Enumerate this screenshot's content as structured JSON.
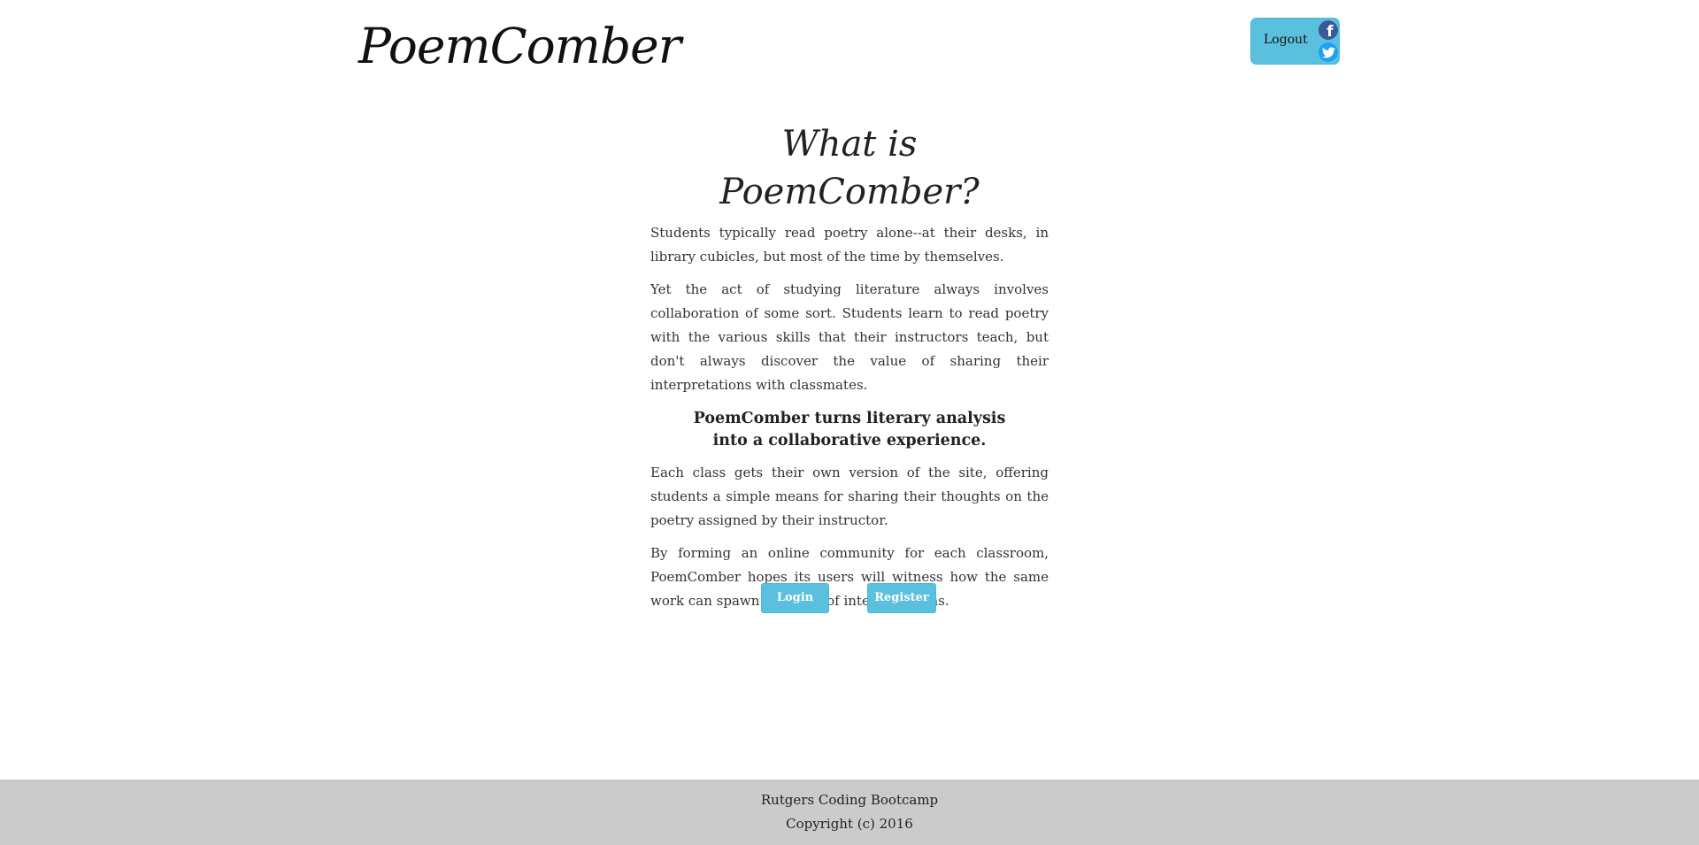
{
  "header": {
    "brand": "PoemComber",
    "logout_label": "Logout",
    "facebook_glyph": "f",
    "icons": [
      "facebook-icon",
      "twitter-icon"
    ]
  },
  "main": {
    "title": "What is PoemComber?",
    "paragraphs": [
      "Students typically read poetry alone--at their desks, in library cubicles, but most of the time by themselves.",
      "Yet the act of studying literature always involves collaboration of some sort. Students learn to read poetry with the various skills that their instructors teach, but don't always discover the value of sharing their interpretations with classmates."
    ],
    "tagline": {
      "line1": "PoemComber turns literary analysis",
      "line2": "into a collaborative experience."
    },
    "paragraphs_after": [
      "Each class gets their own version of the site, offering students a simple means for sharing their thoughts on the poetry assigned by their instructor.",
      "By forming an online community for each classroom, PoemComber hopes its users will witness how the same work can spawn a bounty of interpretations."
    ]
  },
  "actions": {
    "login_label": "Login",
    "register_label": "Register"
  },
  "footer": {
    "line1": "Rutgers Coding Bootcamp",
    "line2": "Copyright (c) 2016"
  },
  "colors": {
    "accent": "#5bc0de",
    "footer_bg": "#cbcbcb",
    "facebook": "#3b5998",
    "twitter": "#1da1f2"
  }
}
